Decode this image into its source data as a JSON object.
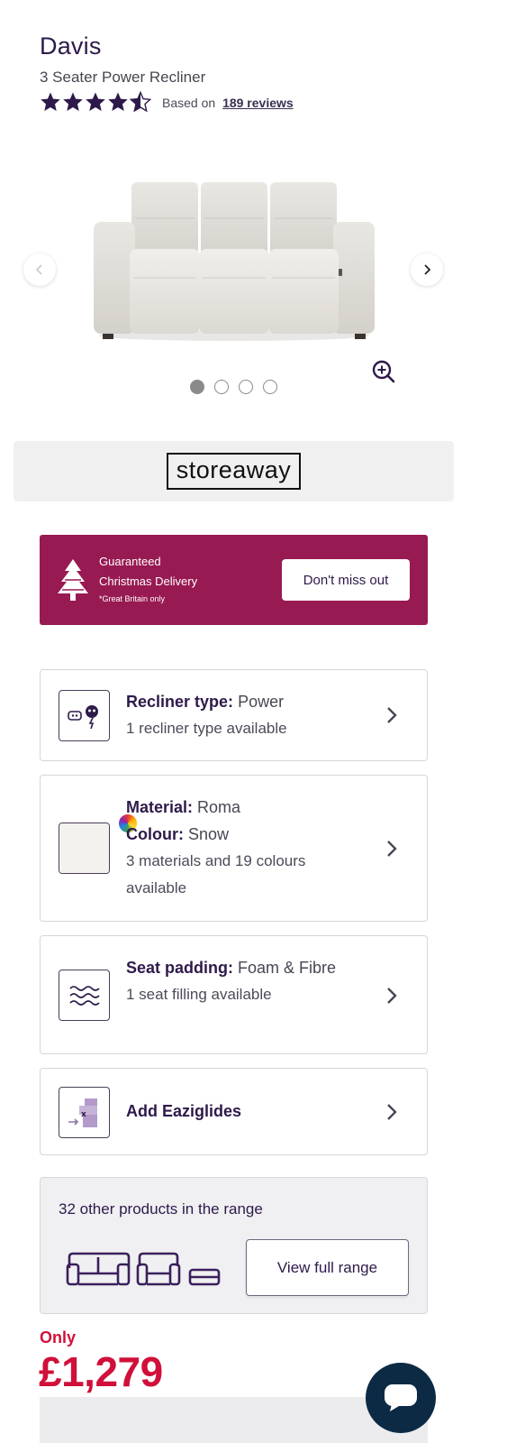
{
  "product": {
    "name": "Davis",
    "subtitle": "3 Seater Power Recliner",
    "rating": 4.5,
    "rating_max": 5,
    "reviews_prefix": "Based on",
    "reviews_link": "189 reviews"
  },
  "gallery": {
    "slide_count": 4,
    "active_slide": 1,
    "prev_icon": "chevron-left-icon",
    "next_icon": "chevron-right-icon",
    "zoom_icon": "zoom-in-icon"
  },
  "storeaway": {
    "logo_text": "storeaway"
  },
  "christmas_banner": {
    "line1": "Guaranteed",
    "line2": "Christmas Delivery",
    "note": "*Great Britain only",
    "button_label": "Don't miss out",
    "background_color": "#981a52"
  },
  "options": [
    {
      "label": "Recliner type:",
      "value": "Power",
      "sub": "1 recliner type available",
      "icon": "recliner-type-icon"
    },
    {
      "label": "Material:",
      "value": "Roma",
      "label2": "Colour:",
      "value2": "Snow",
      "sub": "3 materials and 19 colours available",
      "icon": "colour-swatch-icon"
    },
    {
      "label": "Seat padding:",
      "value": "Foam & Fibre",
      "sub": "1 seat filling available",
      "icon": "seat-padding-icon"
    },
    {
      "label": "Add Eaziglides",
      "icon": "eaziglides-icon"
    }
  ],
  "range": {
    "title": "32 other products in the range",
    "button_label": "View full range"
  },
  "price": {
    "prefix": "Only",
    "amount": "£1,279",
    "color": "#d0103a"
  },
  "chat": {
    "icon": "chat-icon",
    "color": "#0c2a44"
  }
}
